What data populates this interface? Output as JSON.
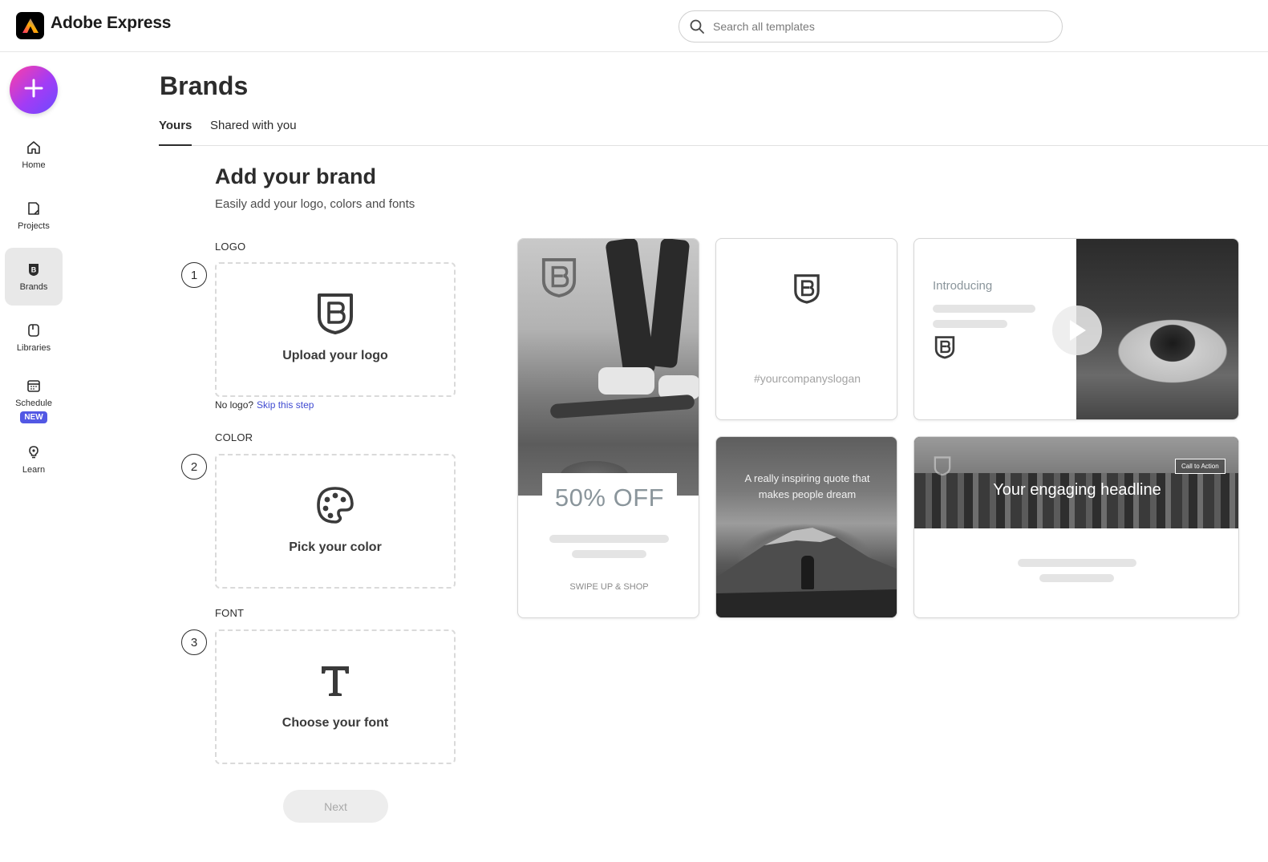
{
  "app": {
    "name": "Adobe Express"
  },
  "search": {
    "placeholder": "Search all templates"
  },
  "rail": {
    "items": [
      {
        "label": "Home",
        "icon": "home-icon"
      },
      {
        "label": "Projects",
        "icon": "projects-icon"
      },
      {
        "label": "Brands",
        "icon": "brands-icon",
        "active": true
      },
      {
        "label": "Libraries",
        "icon": "libraries-icon"
      },
      {
        "label": "Schedule",
        "icon": "calendar-icon",
        "badge": "NEW"
      },
      {
        "label": "Learn",
        "icon": "lightbulb-icon"
      }
    ]
  },
  "page": {
    "title": "Brands",
    "tabs": [
      {
        "label": "Yours",
        "active": true
      },
      {
        "label": "Shared with you",
        "active": false
      }
    ]
  },
  "brand_setup": {
    "title": "Add your brand",
    "subtitle": "Easily add your logo, colors and fonts",
    "steps": [
      {
        "number": "1",
        "label": "LOGO",
        "action": "Upload your logo",
        "icon": "brand-shield-icon"
      },
      {
        "number": "2",
        "label": "COLOR",
        "action": "Pick your color",
        "icon": "palette-icon"
      },
      {
        "number": "3",
        "label": "FONT",
        "action": "Choose your font",
        "icon": "font-t-icon"
      }
    ],
    "no_logo_text": "No logo?",
    "skip_link": "Skip this step",
    "next_label": "Next"
  },
  "previews": {
    "offer": "50% OFF",
    "swipe": "SWIPE UP & SHOP",
    "slogan": "#yourcompanyslogan",
    "introducing": "Introducing",
    "quote": "A really inspiring quote that makes people dream",
    "headline": "Your engaging headline",
    "cta": "Call to Action"
  },
  "colors": {
    "accent": "#5258e4",
    "link": "#3f4ad1",
    "create_gradient_start": "#ff3ea5",
    "create_gradient_end": "#6a4bff"
  }
}
